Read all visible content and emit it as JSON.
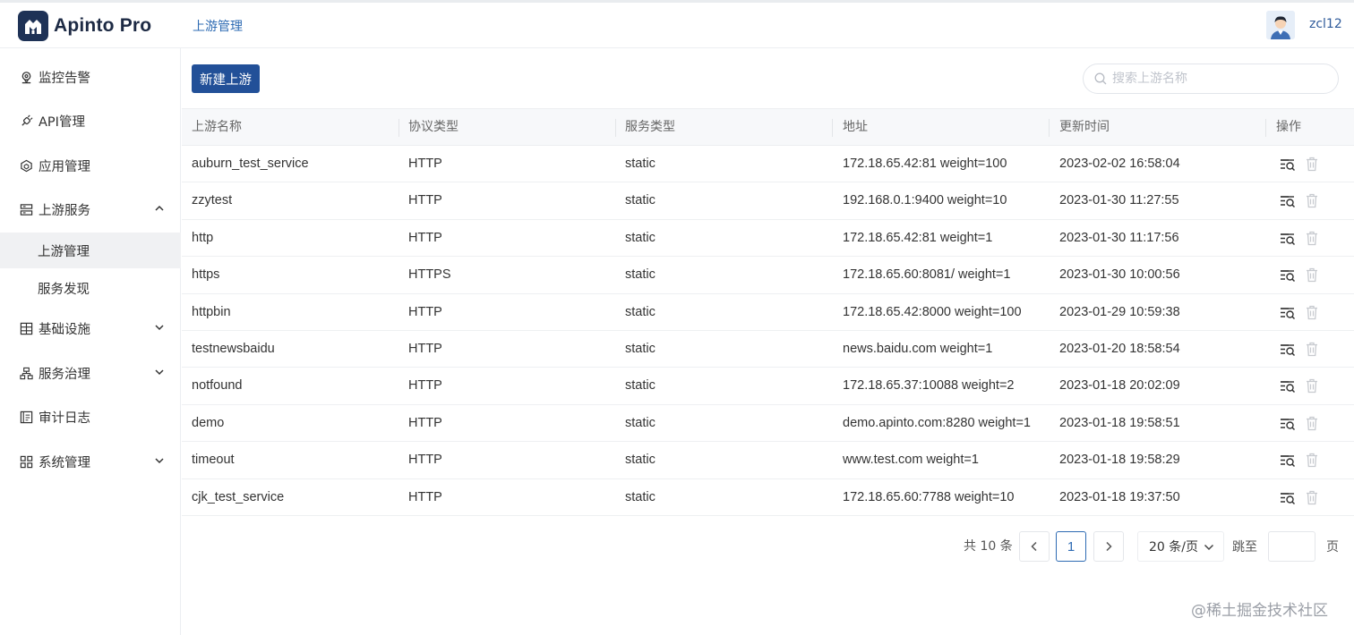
{
  "app": {
    "name": "Apinto Pro",
    "breadcrumb": "上游管理",
    "username": "zcl12"
  },
  "sidebar": {
    "items": [
      {
        "label": "监控告警",
        "icon": "location-pin-icon"
      },
      {
        "label": "API管理",
        "icon": "plug-icon"
      },
      {
        "label": "应用管理",
        "icon": "cube-icon"
      },
      {
        "label": "上游服务",
        "icon": "server-icon",
        "expanded": true
      },
      {
        "label": "基础设施",
        "icon": "grid-icon"
      },
      {
        "label": "服务治理",
        "icon": "org-tree-icon"
      },
      {
        "label": "审计日志",
        "icon": "log-book-icon"
      },
      {
        "label": "系统管理",
        "icon": "apps-icon"
      }
    ],
    "sub_items": [
      {
        "label": "上游管理",
        "active": true
      },
      {
        "label": "服务发现",
        "active": false
      }
    ]
  },
  "toolbar": {
    "new_label": "新建上游",
    "search_placeholder": "搜索上游名称"
  },
  "table": {
    "columns": [
      "上游名称",
      "协议类型",
      "服务类型",
      "地址",
      "更新时间",
      "操作"
    ],
    "rows": [
      {
        "name": "auburn_test_service",
        "protocol": "HTTP",
        "service_type": "static",
        "address": "172.18.65.42:81 weight=100",
        "updated": "2023-02-02 16:58:04"
      },
      {
        "name": "zzytest",
        "protocol": "HTTP",
        "service_type": "static",
        "address": "192.168.0.1:9400 weight=10",
        "updated": "2023-01-30 11:27:55"
      },
      {
        "name": "http",
        "protocol": "HTTP",
        "service_type": "static",
        "address": "172.18.65.42:81 weight=1",
        "updated": "2023-01-30 11:17:56"
      },
      {
        "name": "https",
        "protocol": "HTTPS",
        "service_type": "static",
        "address": "172.18.65.60:8081/ weight=1",
        "updated": "2023-01-30 10:00:56"
      },
      {
        "name": "httpbin",
        "protocol": "HTTP",
        "service_type": "static",
        "address": "172.18.65.42:8000 weight=100",
        "updated": "2023-01-29 10:59:38"
      },
      {
        "name": "testnewsbaidu",
        "protocol": "HTTP",
        "service_type": "static",
        "address": "news.baidu.com weight=1",
        "updated": "2023-01-20 18:58:54"
      },
      {
        "name": "notfound",
        "protocol": "HTTP",
        "service_type": "static",
        "address": "172.18.65.37:10088 weight=2",
        "updated": "2023-01-18 20:02:09"
      },
      {
        "name": "demo",
        "protocol": "HTTP",
        "service_type": "static",
        "address": "demo.apinto.com:8280 weight=1",
        "updated": "2023-01-18 19:58:51"
      },
      {
        "name": "timeout",
        "protocol": "HTTP",
        "service_type": "static",
        "address": "www.test.com weight=1",
        "updated": "2023-01-18 19:58:29"
      },
      {
        "name": "cjk_test_service",
        "protocol": "HTTP",
        "service_type": "static",
        "address": "172.18.65.60:7788 weight=10",
        "updated": "2023-01-18 19:37:50"
      }
    ]
  },
  "pagination": {
    "total_text": "共 10 条",
    "current_page": "1",
    "page_size": "20 条/页",
    "jump_label": "跳至",
    "page_label": "页"
  },
  "watermark": "@稀土掘金技术社区",
  "colors": {
    "primary": "#225098",
    "link": "#2e6bb3",
    "logo_bg": "#1e3256"
  }
}
